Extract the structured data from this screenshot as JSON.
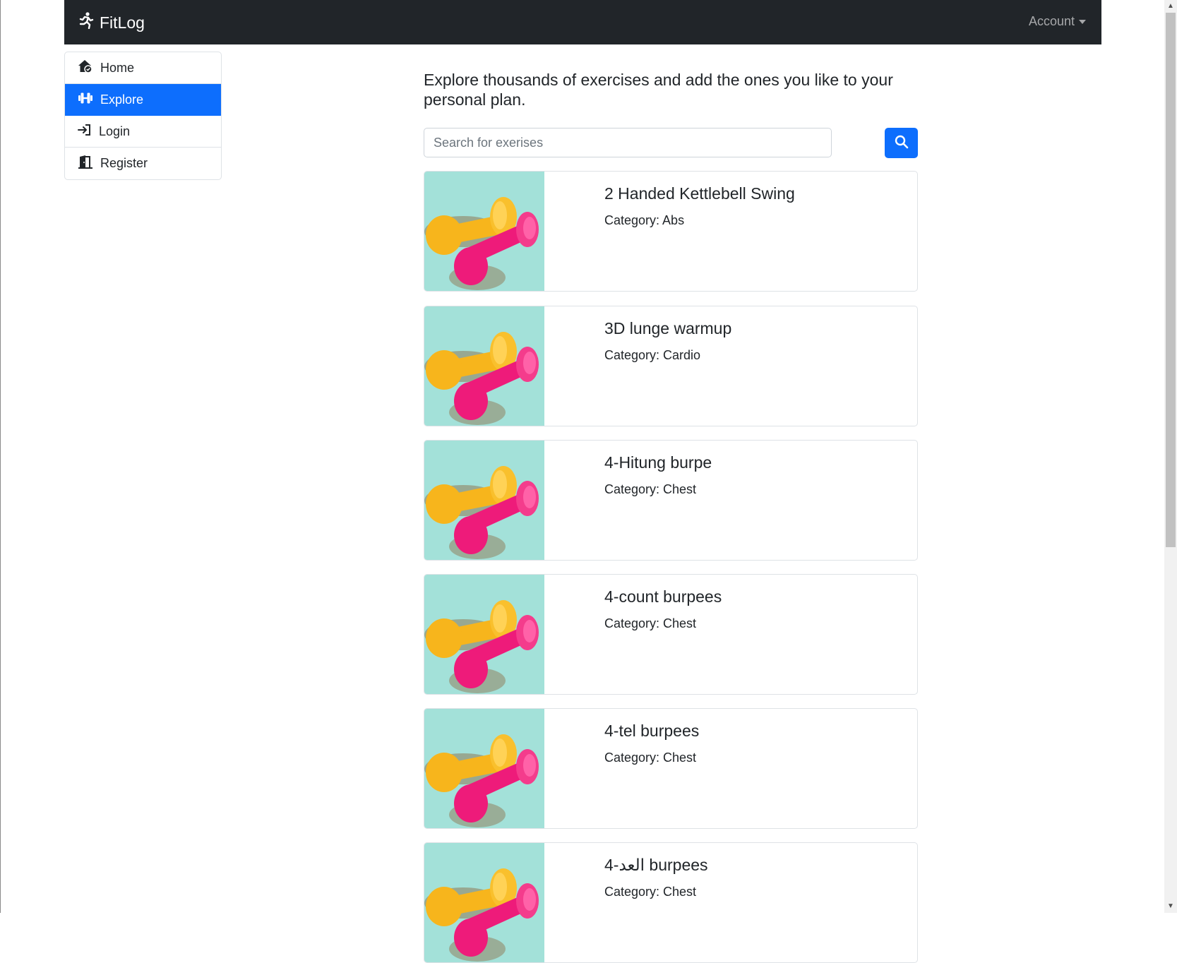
{
  "navbar": {
    "brand": "FitLog",
    "account_label": "Account"
  },
  "sidebar": {
    "items": [
      {
        "label": "Home",
        "icon": "home-icon"
      },
      {
        "label": "Explore",
        "icon": "dumbbell-icon",
        "active": true
      },
      {
        "label": "Login",
        "icon": "login-icon"
      },
      {
        "label": "Register",
        "icon": "door-icon"
      }
    ]
  },
  "main": {
    "headline": "Explore thousands of exercises and add the ones you like to your personal plan.",
    "search": {
      "placeholder": "Search for exerises",
      "value": "",
      "button_icon": "search-icon"
    },
    "exercises": [
      {
        "name": "2 Handed Kettlebell Swing",
        "category": "Category: Abs"
      },
      {
        "name": "3D lunge warmup",
        "category": "Category: Cardio"
      },
      {
        "name": "4-Hitung burpe",
        "category": "Category: Chest"
      },
      {
        "name": "4-count burpees",
        "category": "Category: Chest"
      },
      {
        "name": "4-tel burpees",
        "category": "Category: Chest"
      },
      {
        "name": "4-العد burpees",
        "category": "Category: Chest"
      }
    ]
  },
  "colors": {
    "navbar_bg": "#212529",
    "accent": "#0d6efd",
    "image_bg": "#a3e1d9",
    "dumbbell_yellow": "#f7b51c",
    "dumbbell_pink": "#ee1b7a"
  }
}
